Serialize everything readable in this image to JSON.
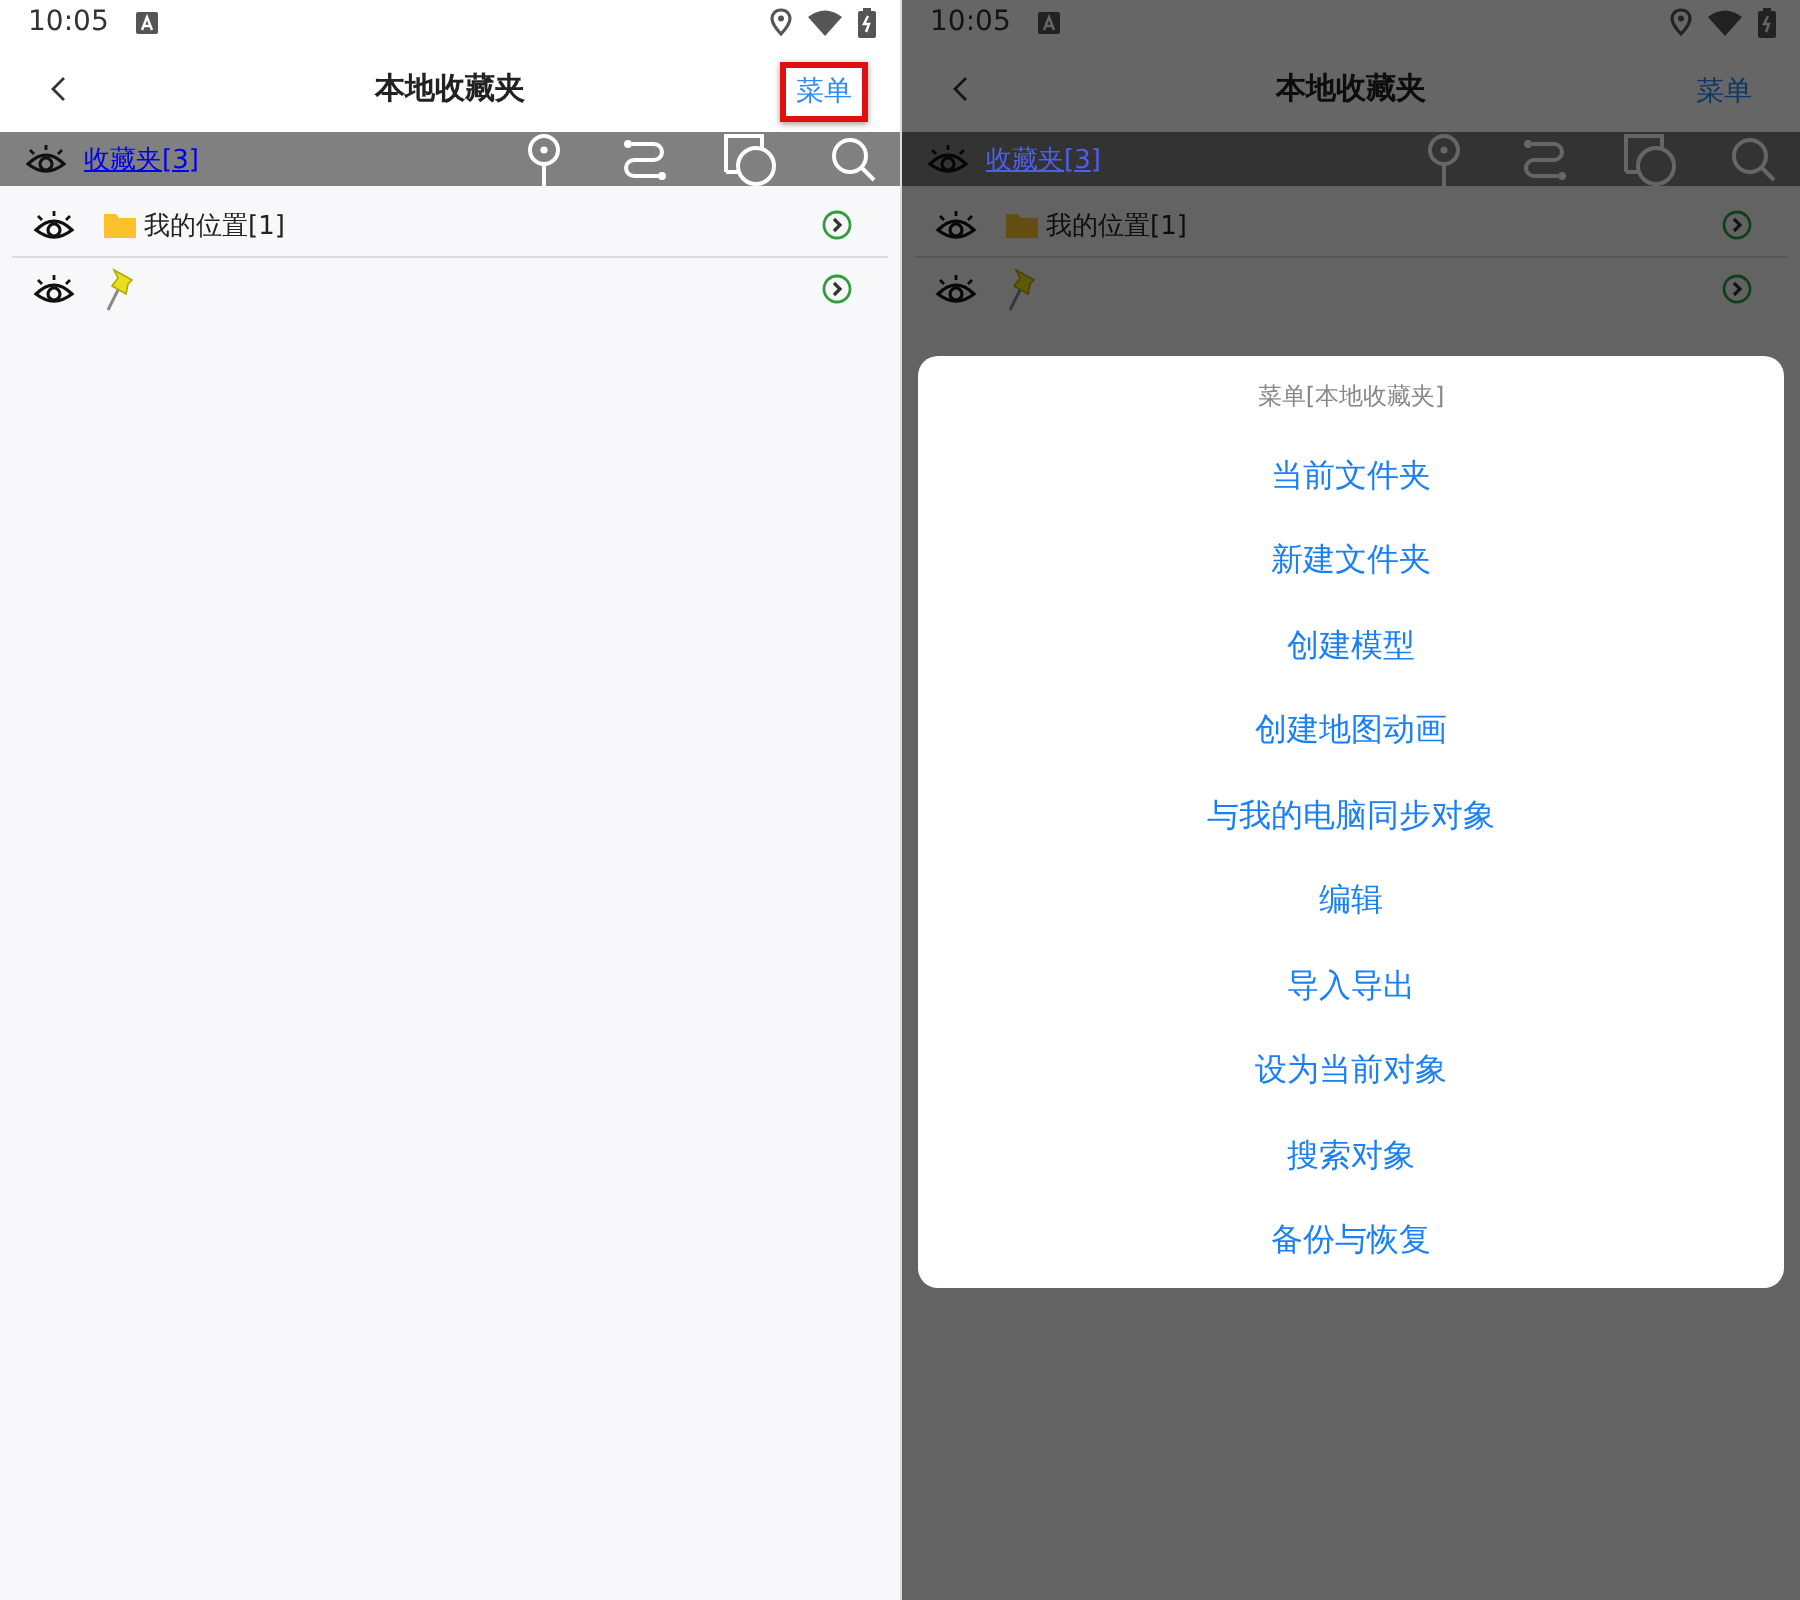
{
  "screens": [
    {
      "status_bar": {
        "time": "10:05"
      },
      "header": {
        "title": "本地收藏夹",
        "menu_button": {
          "label": "菜单",
          "highlighted": true
        }
      },
      "toolbar": {
        "link": "收藏夹[3]"
      },
      "rows": [
        {
          "kind": "folder",
          "label": "我的位置[1]"
        },
        {
          "kind": "pin"
        }
      ],
      "dimmed": false
    },
    {
      "status_bar": {
        "time": "10:05"
      },
      "header": {
        "title": "本地收藏夹",
        "menu_button": {
          "label": "菜单",
          "highlighted": false
        }
      },
      "toolbar": {
        "link": "收藏夹[3]"
      },
      "rows": [
        {
          "kind": "folder",
          "label": "我的位置[1]"
        },
        {
          "kind": "pin"
        }
      ],
      "dimmed": true,
      "dialog": {
        "title": "菜单[本地收藏夹]",
        "items": [
          "当前文件夹",
          "新建文件夹",
          "创建模型",
          "创建地图动画",
          "与我的电脑同步对象",
          "编辑",
          "导入导出",
          "设为当前对象",
          "搜索对象",
          "备份与恢复"
        ]
      }
    }
  ]
}
